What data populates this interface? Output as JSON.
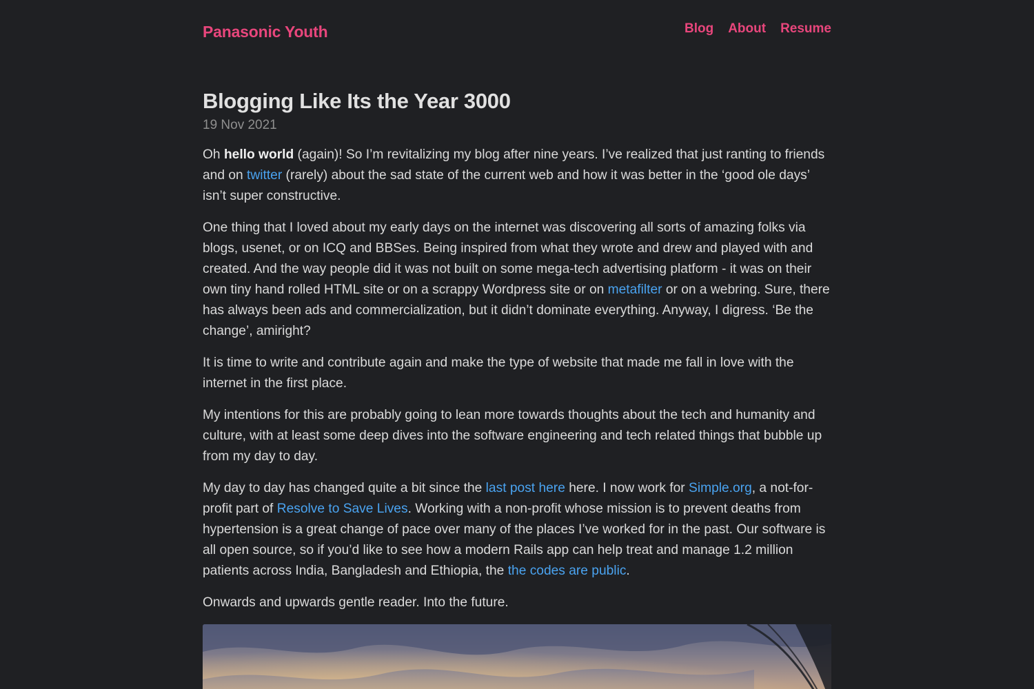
{
  "site": {
    "title": "Panasonic Youth",
    "nav": [
      "Blog",
      "About",
      "Resume"
    ]
  },
  "post": {
    "title": "Blogging Like Its the Year 3000",
    "date": "19 Nov 2021",
    "p1": {
      "a": "Oh ",
      "bold": "hello world",
      "b": " (again)! So I’m revitalizing my blog after nine years. I’ve realized that just ranting to friends and on ",
      "link_twitter": "twitter",
      "c": " (rarely) about the sad state of the current web and how it was better in the ‘good ole days’ isn’t super constructive."
    },
    "p2": {
      "a": "One thing that I loved about my early days on the internet was discovering all sorts of amazing folks via blogs, usenet, or on ICQ and BBSes. Being inspired from what they wrote and drew and played with and created. And the way people did it was not built on some mega-tech advertising platform - it was on their own tiny hand rolled HTML site or on a scrappy Wordpress site or on ",
      "link_metafilter": "metafilter",
      "b": " or on a webring. Sure, there has always been ads and commercialization, but it didn’t dominate everything. Anyway, I digress. ‘Be the change’, amiright?"
    },
    "p3": "It is time to write and contribute again and make the type of website that made me fall in love with the internet in the first place.",
    "p4": "My intentions for this are probably going to lean more towards thoughts about the tech and humanity and culture, with at least some deep dives into the software engineering and tech related things that bubble up from my day to day.",
    "p5": {
      "a": "My day to day has changed quite a bit since the ",
      "link_last_post": "last post here",
      "b": " here. I now work for ",
      "link_simple": "Simple.org",
      "c": ", a not-for-profit part of ",
      "link_resolve": "Resolve to Save Lives",
      "d": ". Working with a non-profit whose mission is to prevent deaths from hypertension is a great change of pace over many of the places I’ve worked for in the past. Our software is all open source, so if you’d like to see how a modern Rails app can help treat and manage 1.2 million patients across India, Bangladesh and Ethiopia, the ",
      "link_codes": "the codes are public",
      "e": "."
    },
    "p6": "Onwards and upwards gentle reader. Into the future."
  },
  "colors": {
    "background": "#1f2023",
    "accent": "#e8467c",
    "link": "#4aa3f0",
    "text": "#dadada",
    "muted": "#8f8f8f"
  }
}
